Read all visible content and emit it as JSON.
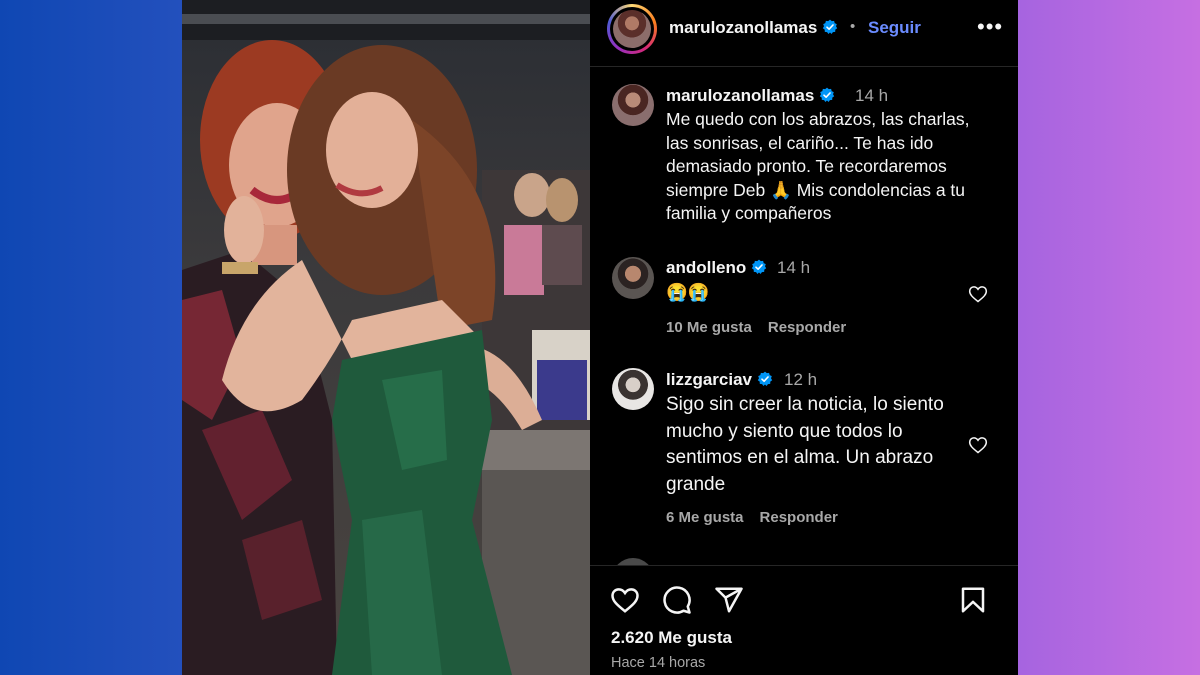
{
  "header": {
    "username": "marulozanollamas",
    "separator": "•",
    "follow_label": "Seguir",
    "more_label": "•••"
  },
  "caption": {
    "username": "marulozanollamas",
    "time": "14 h",
    "text_lines": [
      "Me quedo con los abrazos, las charlas,",
      "las sonrisas, el cariño... Te has ido",
      "demasiado pronto. Te recordaremos",
      "siempre Deb 🙏 Mis condolencias a tu",
      "familia y compañeros"
    ]
  },
  "comments": [
    {
      "username": "andolleno",
      "time": "14 h",
      "text_lines": [
        "😭😭"
      ],
      "likes": "10 Me gusta",
      "reply": "Responder"
    },
    {
      "username": "lizzgarciav",
      "time": "12 h",
      "text_lines": [
        "Sigo sin creer la noticia, lo siento",
        "mucho y siento que todos lo",
        "sentimos en el alma. Un abrazo",
        "grande"
      ],
      "likes": "6 Me gusta",
      "reply": "Responder"
    }
  ],
  "footer": {
    "likes": "2.620 Me gusta",
    "posted": "Hace 14 horas"
  },
  "colors": {
    "panel_bg": "#000000",
    "link_blue": "#6b8cff",
    "verified_blue": "#0095f6",
    "muted_text": "#a8a8a8"
  },
  "icons": [
    "verified-badge-icon",
    "heart-icon",
    "comment-icon",
    "share-icon",
    "bookmark-icon",
    "more-icon"
  ]
}
